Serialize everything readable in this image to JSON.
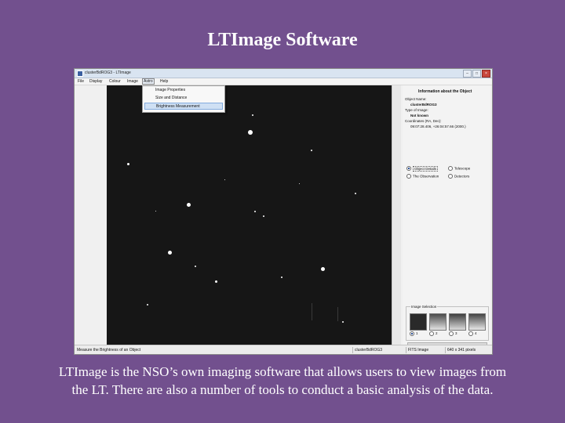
{
  "slide": {
    "title": "LTImage Software",
    "caption_line1": "LTImage is the NSO’s own imaging software that allows users to view images from",
    "caption_line2": "the LT. There are also a number of tools to conduct a basic analysis of the data."
  },
  "window": {
    "title": "clusterBdROG3 - LTImage",
    "controls": [
      "–",
      "□",
      "×"
    ]
  },
  "menubar": {
    "items": [
      "File",
      "Display",
      "Colour",
      "Image",
      "Astro",
      "Help"
    ],
    "active_item": "Astro"
  },
  "dropdown": {
    "items": [
      "Image Properties",
      "Size and Distance",
      "Brightness Measurement"
    ],
    "highlighted": "Brightness Measurement"
  },
  "info_panel": {
    "title": "Information about the Object",
    "object_name_label": "Object Name:",
    "object_name": "clusterBdROG3",
    "type_label": "Type of Image:",
    "type_value": "Not known",
    "coords_label": "Coordinates (RA, Dec):",
    "coords_value": "09:07:28.406, +26:04:57.66 (2000.)",
    "options": [
      {
        "label": "Object Details",
        "selected": true
      },
      {
        "label": "Telescope",
        "selected": false
      },
      {
        "label": "The Observation",
        "selected": false
      },
      {
        "label": "Detectors",
        "selected": false
      }
    ]
  },
  "image_selection": {
    "legend": "Image Selection",
    "radios": [
      "1",
      "2",
      "3",
      "4"
    ],
    "selected": "1"
  },
  "statusbar": {
    "message": "Measure the Brightness of an Object",
    "object": "clusterBdROG3",
    "format": "FITS Image",
    "size": "640 x 341 pixels"
  },
  "colors": {
    "slide_background": "#72508e",
    "image_background": "#161616",
    "selection_highlight": "#cfe0f4"
  }
}
